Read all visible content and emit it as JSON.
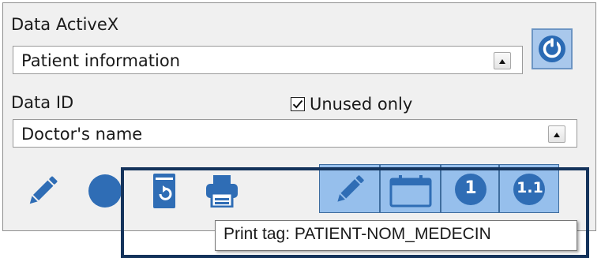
{
  "panel": {
    "activex_label": "Data ActiveX",
    "activex_value": "Patient information",
    "data_id_label": "Data ID",
    "data_id_value": "Doctor's name",
    "unused_only_label": "Unused only",
    "unused_only_checked": true
  },
  "toolbar": {
    "icons": [
      "pencil-icon",
      "circle-icon",
      "reload-document-icon",
      "printer-icon"
    ],
    "tab_icons": [
      "pencil-icon",
      "calendar-icon",
      "number-1-icon",
      "number-1-1-icon"
    ],
    "tab_1_text": "1",
    "tab_11_text": "1.1"
  },
  "tooltip": {
    "text": "Print tag: PATIENT-NOM_MEDECIN"
  },
  "colors": {
    "accent_blue": "#2f6db5",
    "button_fill": "#96bfec",
    "frame": "#14335b",
    "panel_bg": "#f0f0f0"
  }
}
